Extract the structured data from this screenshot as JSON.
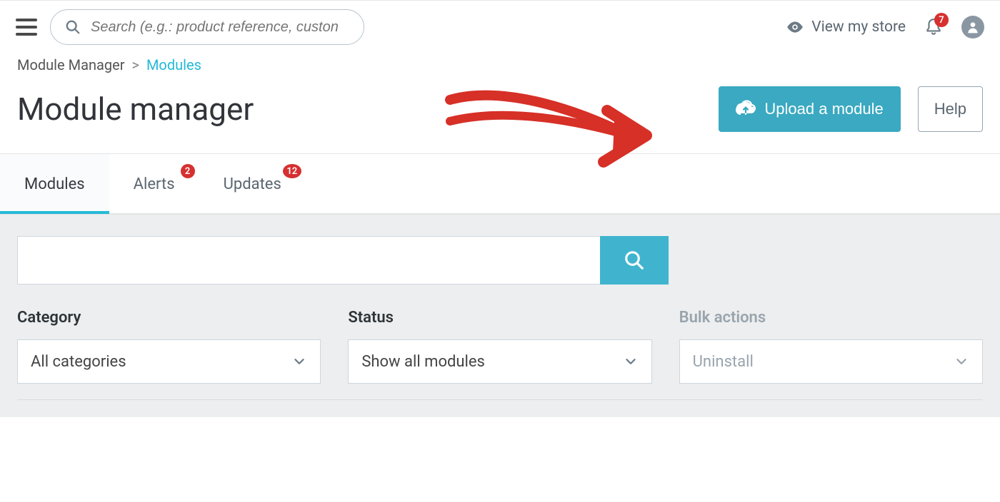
{
  "topbar": {
    "search_placeholder": "Search (e.g.: product reference, custon",
    "view_store": "View my store",
    "notifications_count": "7"
  },
  "breadcrumb": {
    "parent": "Module Manager",
    "separator": ">",
    "current": "Modules"
  },
  "page": {
    "title": "Module manager",
    "upload_button": "Upload a module",
    "help_button": "Help"
  },
  "tabs": [
    {
      "label": "Modules",
      "badge": null,
      "active": true
    },
    {
      "label": "Alerts",
      "badge": "2",
      "active": false
    },
    {
      "label": "Updates",
      "badge": "12",
      "active": false
    }
  ],
  "filters": {
    "category": {
      "label": "Category",
      "value": "All categories"
    },
    "status": {
      "label": "Status",
      "value": "Show all modules"
    },
    "bulk": {
      "label": "Bulk actions",
      "value": "Uninstall"
    }
  },
  "colors": {
    "accent": "#25b9d7",
    "primary_btn": "#3aa9c1",
    "badge": "#d63031"
  }
}
